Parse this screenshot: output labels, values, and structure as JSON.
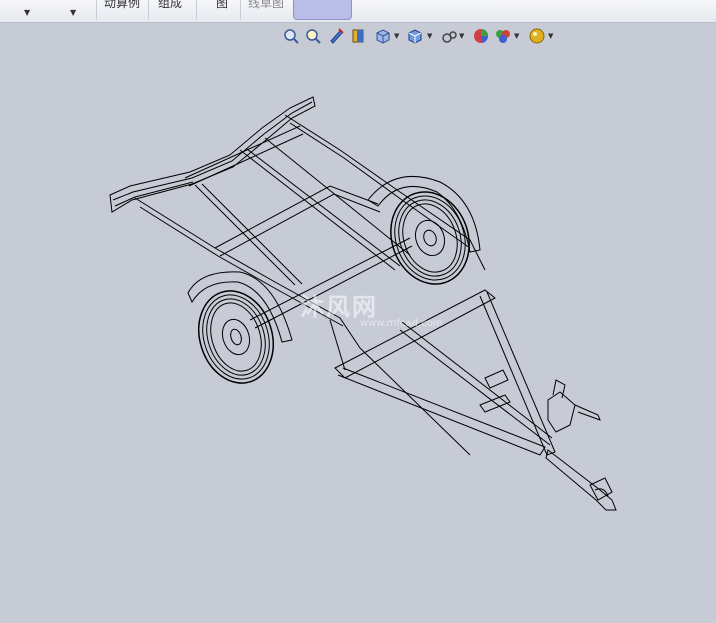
{
  "command_bar": {
    "tab_1": "动算例",
    "tab_2": "组成",
    "tab_3": "图",
    "tab_4": "线草图"
  },
  "view_toolbar": {
    "icons": [
      "zoom-to-fit-icon",
      "zoom-area-icon",
      "previous-view-icon",
      "section-view-icon",
      "view-orientation-icon",
      "display-style-icon",
      "hide-show-items-icon",
      "edit-appearance-icon",
      "apply-scene-icon",
      "view-settings-icon"
    ]
  },
  "watermark": {
    "brand": "沐风网",
    "url": "www.mfcad.com"
  },
  "colors": {
    "viewport_bg": "#c6cbd6",
    "wire": "#000000",
    "active_tab": "#b9bde8"
  }
}
